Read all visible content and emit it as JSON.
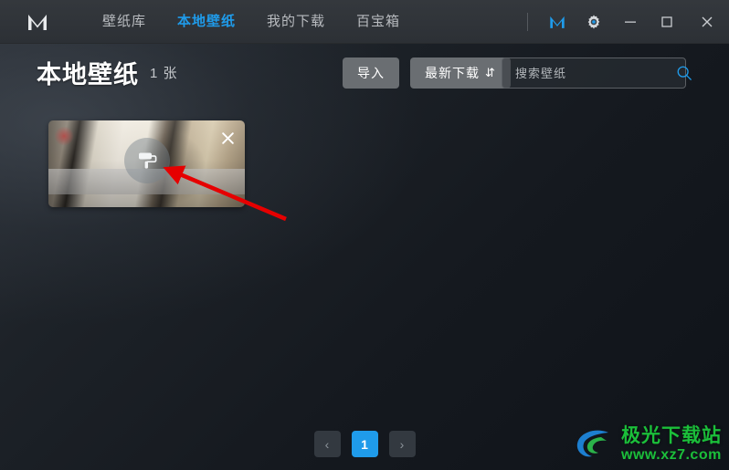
{
  "window": {
    "logo_icon": "m-logo-icon",
    "nav": [
      {
        "label": "壁纸库",
        "active": false
      },
      {
        "label": "本地壁纸",
        "active": true
      },
      {
        "label": "我的下载",
        "active": false
      },
      {
        "label": "百宝箱",
        "active": false
      }
    ],
    "controls": {
      "account_icon": "m-account-icon",
      "settings_icon": "gear-icon",
      "minimize_icon": "minimize-icon",
      "maximize_icon": "maximize-icon",
      "close_icon": "close-icon"
    }
  },
  "header": {
    "title": "本地壁纸",
    "count": "1 张"
  },
  "toolbar": {
    "import_label": "导入",
    "sort_label": "最新下载",
    "sort_glyph": "⇵"
  },
  "search": {
    "placeholder": "搜索壁纸",
    "value": "",
    "icon": "search-icon"
  },
  "gallery": {
    "items": [
      {
        "name": "local-wallpaper-1",
        "apply_icon": "paint-roller-icon",
        "delete_icon": "close-icon"
      }
    ]
  },
  "pagination": {
    "prev_glyph": "‹",
    "next_glyph": "›",
    "pages": [
      {
        "label": "1",
        "active": true
      }
    ]
  },
  "watermark": {
    "title": "极光下载站",
    "url": "www.xz7.com"
  },
  "colors": {
    "accent": "#1f9bea",
    "titlebar": "#303439",
    "background": "#15191f",
    "button": "#6a6e72",
    "watermark_green": "#1bbf3a",
    "annotation_red": "#e60000"
  }
}
